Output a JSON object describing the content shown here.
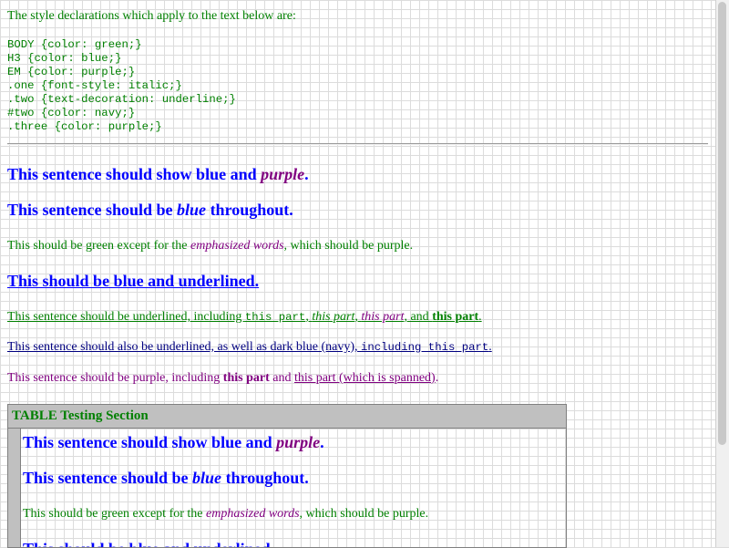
{
  "intro": "The style declarations which apply to the text below are:",
  "styles": [
    "BODY {color: green;}",
    "H3 {color: blue;}",
    "EM {color: purple;}",
    ".one {font-style: italic;}",
    ".two {text-decoration: underline;}",
    "#two {color: navy;}",
    ".three {color: purple;}"
  ],
  "s1": {
    "a": "This sentence should show blue and ",
    "em": "purple",
    "b": "."
  },
  "s2": {
    "a": "This sentence should be ",
    "em": "blue",
    "b": " throughout."
  },
  "s3": {
    "a": "This should be green except for the ",
    "em": "emphasized words",
    "b": ", which should be purple."
  },
  "s4": {
    "text": "This should be blue and underlined."
  },
  "s5": {
    "a": "This sentence should be underlined, including ",
    "tt": "this part",
    "c1": ", ",
    "i": "this part",
    "c2": ", ",
    "em": "this part",
    "c3": ", and ",
    "strong": "this part",
    "c4": "."
  },
  "s6": {
    "a": "This sentence should also be underlined, as well as dark blue (navy), ",
    "tt": "including this part",
    "b": "."
  },
  "s7": {
    "a": "This sentence should be purple, including ",
    "strong": "this part",
    "b": " and ",
    "span": "this part (which is spanned)",
    "c": "."
  },
  "table": {
    "caption": "TABLE Testing Section",
    "t1": {
      "a": "This sentence should show blue and ",
      "em": "purple",
      "b": "."
    },
    "t2": {
      "a": "This sentence should be ",
      "em": "blue",
      "b": " throughout."
    },
    "t3": {
      "a": "This should be green except for the ",
      "em": "emphasized words",
      "b": ", which should be purple."
    },
    "t4": {
      "text": "This should be blue and underlined."
    }
  },
  "colors": {
    "green": "#008000",
    "blue": "#0000ff",
    "purple": "#800080",
    "navy": "#000080"
  }
}
